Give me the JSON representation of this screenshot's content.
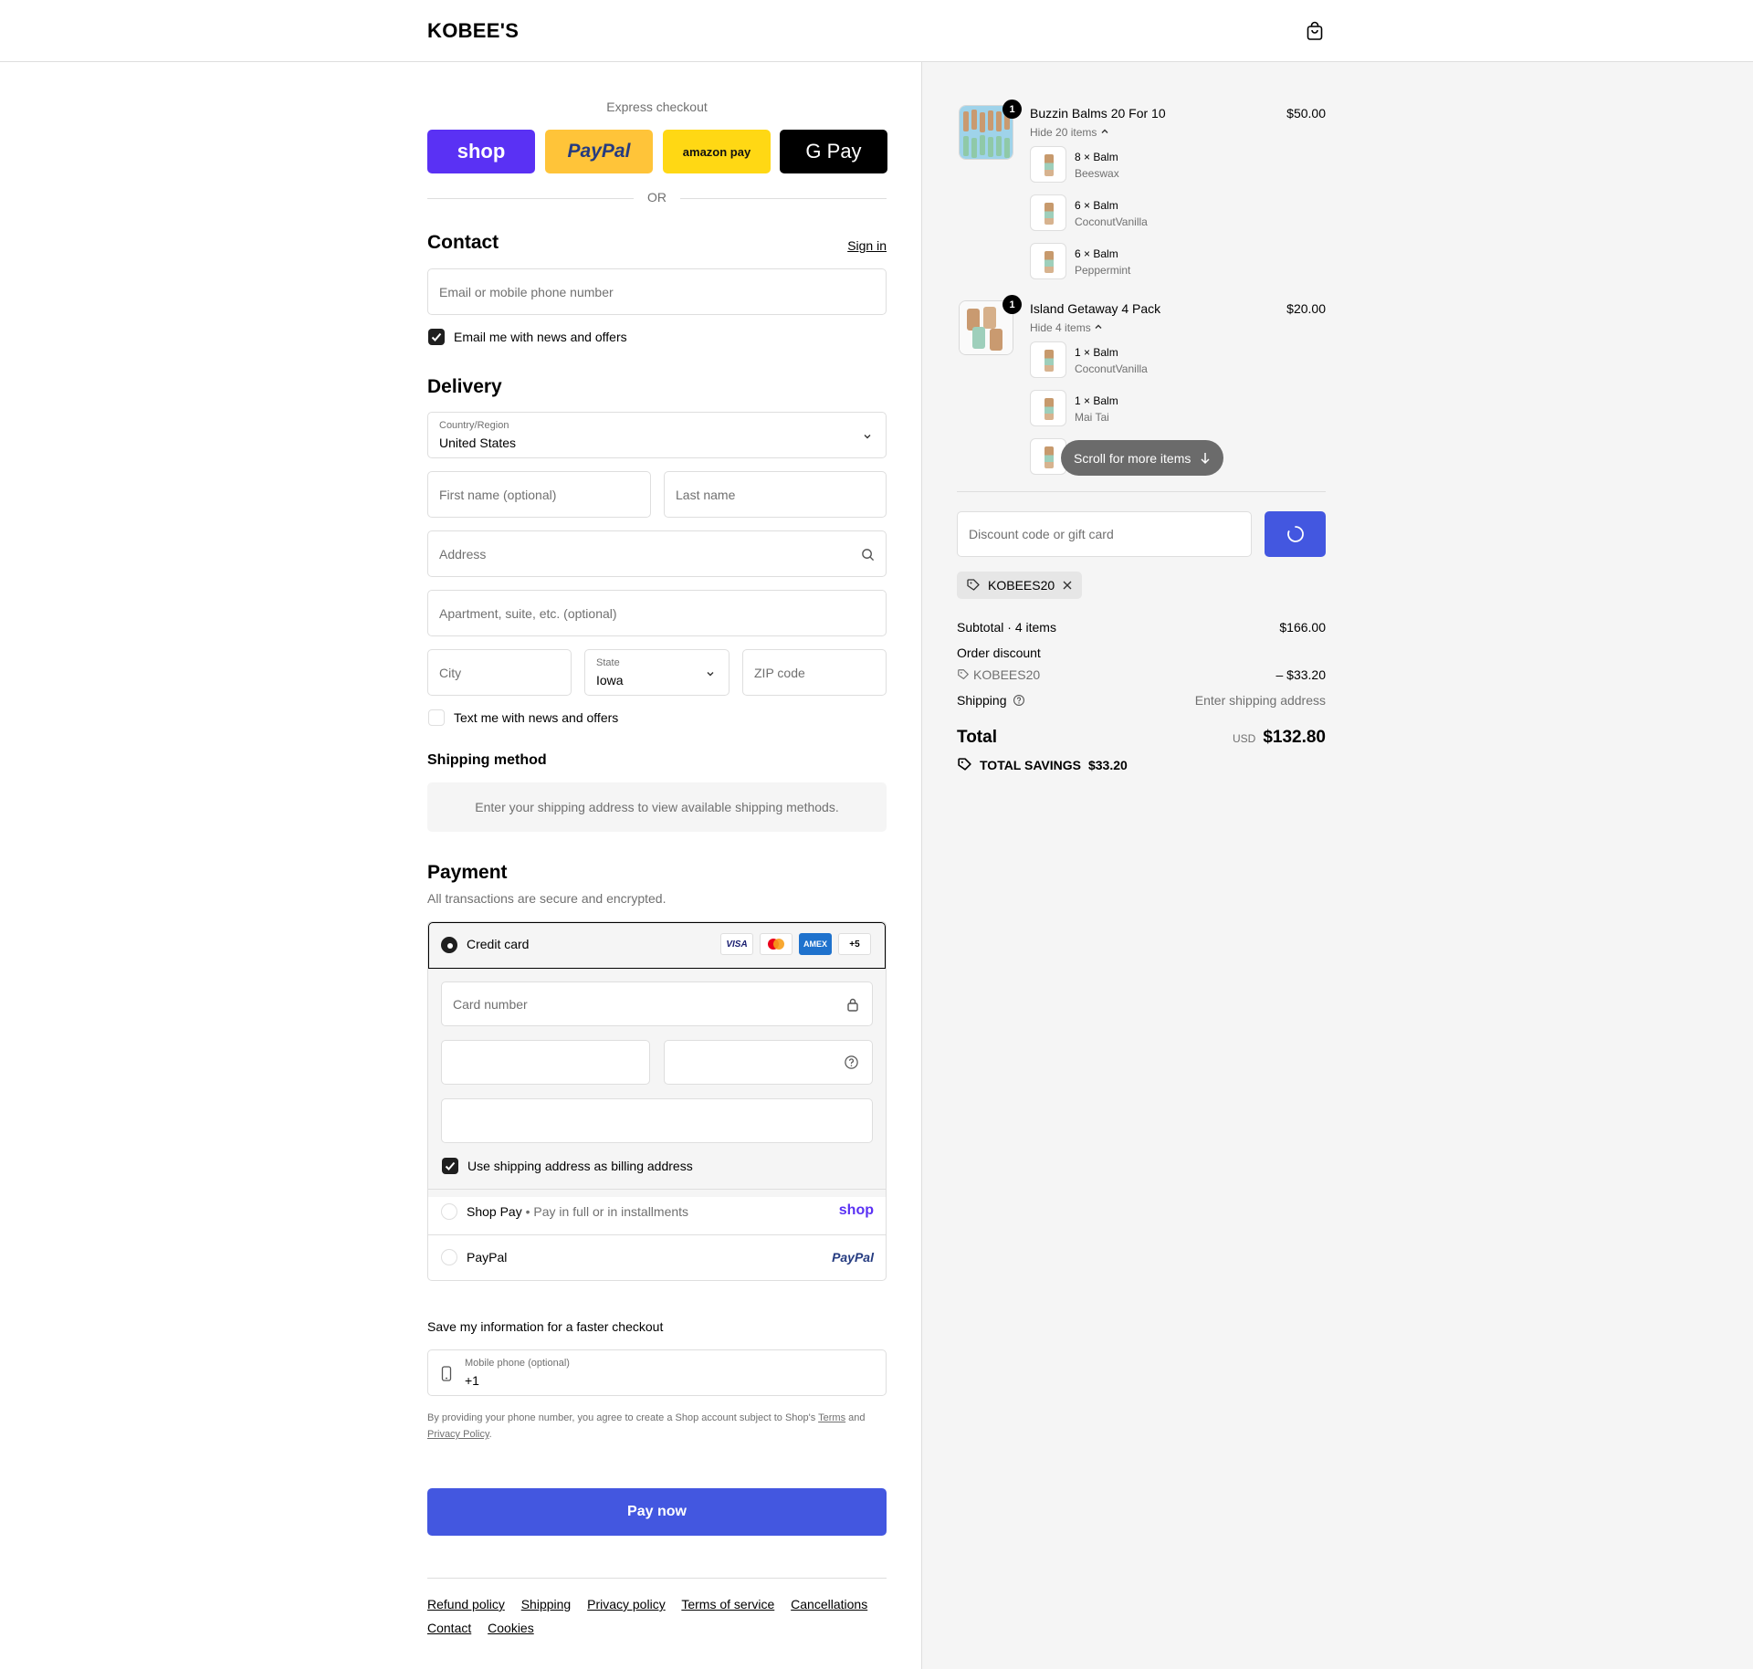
{
  "brand": {
    "name": "KOBEE'S",
    "accent": "#4357e0",
    "shop_purple": "#5a31f4",
    "paypal_yellow": "#ffc439",
    "amazon_yellow": "#ffd814"
  },
  "express": {
    "title": "Express checkout",
    "buttons": [
      {
        "name": "shop",
        "label": "shop"
      },
      {
        "name": "paypal",
        "label": "PayPal"
      },
      {
        "name": "amazon-pay",
        "label": "amazon pay"
      },
      {
        "name": "google-pay",
        "label": "G Pay"
      }
    ],
    "or": "OR"
  },
  "contact": {
    "title": "Contact",
    "sign_in": "Sign in",
    "email_placeholder": "Email or mobile phone number",
    "news_label": "Email me with news and offers"
  },
  "delivery": {
    "title": "Delivery",
    "country_label": "Country/Region",
    "country_value": "United States",
    "first_name_placeholder": "First name (optional)",
    "last_name_placeholder": "Last name",
    "address_placeholder": "Address",
    "apartment_placeholder": "Apartment, suite, etc. (optional)",
    "city_placeholder": "City",
    "state_label": "State",
    "state_value": "Iowa",
    "zip_placeholder": "ZIP code",
    "text_label": "Text me with news and offers"
  },
  "shipping_method": {
    "title": "Shipping method",
    "notice": "Enter your shipping address to view available shipping methods."
  },
  "payment": {
    "title": "Payment",
    "subtitle": "All transactions are secure and encrypted.",
    "credit_card_label": "Credit card",
    "card_brands": [
      "VISA",
      "MC",
      "AMEX",
      "+5"
    ],
    "card_number_placeholder": "Card number",
    "billing_label": "Use shipping address as billing address",
    "shop_pay_label": "Shop Pay",
    "shop_pay_sub": "Pay in full or in installments",
    "shop_pay_logo": "shop",
    "paypal_label": "PayPal",
    "paypal_logo": "PayPal"
  },
  "save_info": {
    "title": "Save my information for a faster checkout",
    "phone_label": "Mobile phone (optional)",
    "phone_value": "+1",
    "legal_prefix": "By providing your phone number, you agree to create a Shop account subject to Shop's",
    "terms": "Terms",
    "and": "and",
    "privacy": "Privacy Policy"
  },
  "pay_now": "Pay now",
  "footer": {
    "links": [
      "Refund policy",
      "Shipping",
      "Privacy policy",
      "Terms of service",
      "Cancellations",
      "Contact",
      "Cookies"
    ]
  },
  "order": {
    "items": [
      {
        "name": "Buzzin Balms 20 For 10",
        "price": "$50.00",
        "qty": "1",
        "toggle": "Hide 20 items",
        "subitems": [
          {
            "name": "8 × Balm",
            "variant": "Beeswax"
          },
          {
            "name": "6 × Balm",
            "variant": "CoconutVanilla"
          },
          {
            "name": "6 × Balm",
            "variant": "Peppermint"
          }
        ]
      },
      {
        "name": "Island Getaway 4 Pack",
        "price": "$20.00",
        "qty": "1",
        "toggle": "Hide 4 items",
        "subitems": [
          {
            "name": "1 × Balm",
            "variant": "CoconutVanilla"
          },
          {
            "name": "1 × Balm",
            "variant": "Mai Tai"
          }
        ]
      }
    ],
    "scroll_hint": "Scroll for more items",
    "discount_placeholder": "Discount code or gift card",
    "applied_code": "KOBEES20",
    "subtotal_label": "Subtotal · 4 items",
    "subtotal_value": "$166.00",
    "order_discount_label": "Order discount",
    "discount_code": "KOBEES20",
    "discount_value": "– $33.20",
    "shipping_label": "Shipping",
    "shipping_value": "Enter shipping address",
    "total_label": "Total",
    "currency": "USD",
    "total_value": "$132.80",
    "savings_label": "TOTAL SAVINGS",
    "savings_value": "$33.20"
  }
}
